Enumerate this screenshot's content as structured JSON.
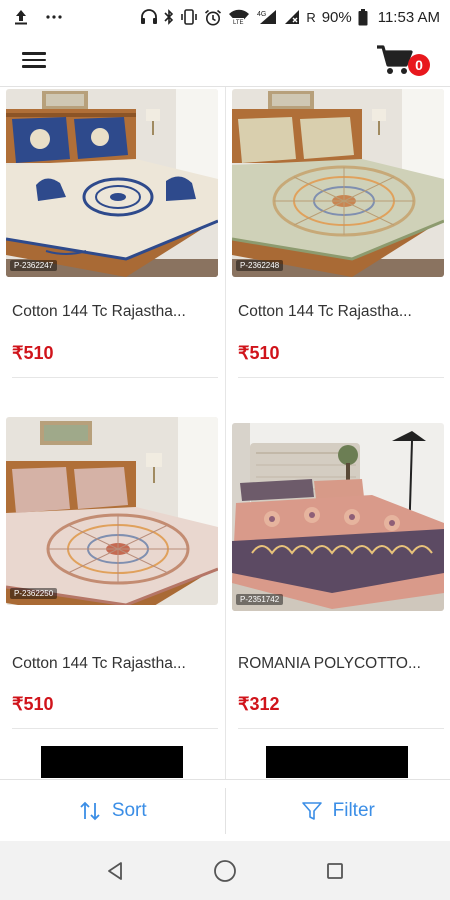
{
  "status_bar": {
    "battery_percent": "90%",
    "time": "11:53 AM",
    "network_label": "4G",
    "roaming_indicator": "R"
  },
  "header": {
    "cart_count": "0"
  },
  "products": [
    {
      "name": "Cotton 144 Tc Rajastha...",
      "price": "₹510",
      "code": "P-2362247",
      "pattern": "blue-elephant"
    },
    {
      "name": "Cotton 144 Tc Rajastha...",
      "price": "₹510",
      "code": "P-2362248",
      "pattern": "mandala-sage"
    },
    {
      "name": "Cotton 144 Tc Rajastha...",
      "price": "₹510",
      "code": "P-2362250",
      "pattern": "mandala-pink"
    },
    {
      "name": "ROMANIA POLYCOTTO...",
      "price": "₹312",
      "code": "P-2351742",
      "pattern": "peach-floral"
    }
  ],
  "action_bar": {
    "sort_label": "Sort",
    "filter_label": "Filter"
  },
  "icons": {
    "menu": "menu-icon",
    "cart": "cart-icon",
    "sort": "sort-arrows-icon",
    "filter": "funnel-icon",
    "back": "back-triangle-icon",
    "home": "home-circle-icon",
    "recents": "recents-square-icon"
  },
  "colors": {
    "price": "#d0141b",
    "accent": "#3b8ee6",
    "badge": "#e8181d"
  }
}
